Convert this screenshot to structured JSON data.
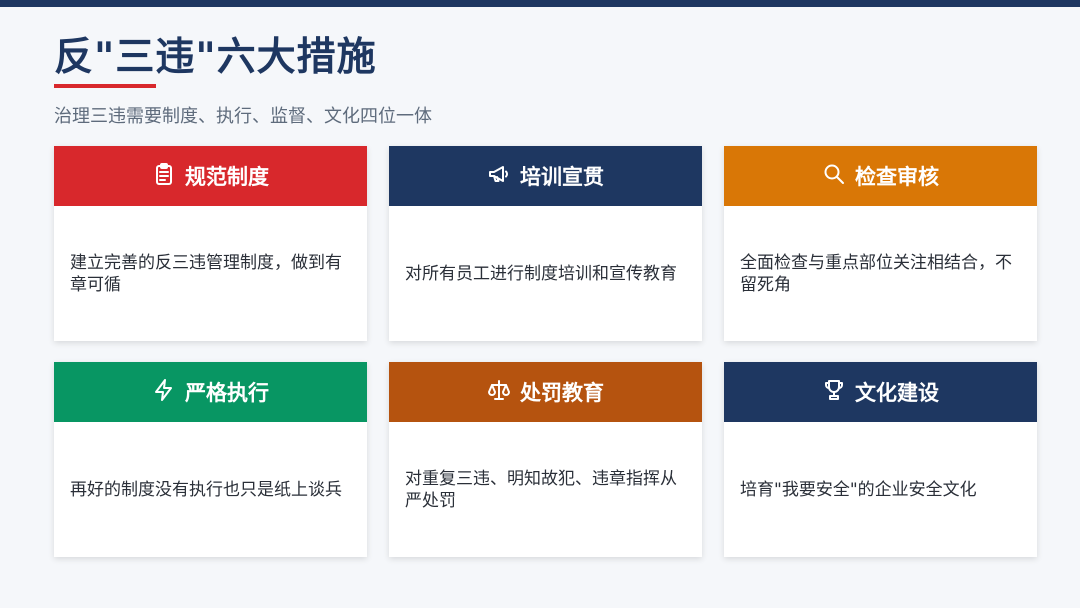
{
  "slide": {
    "title": "反\"三违\"六大措施",
    "subtitle": "治理三违需要制度、执行、监督、文化四位一体"
  },
  "colors": {
    "navy": "#1e3761",
    "red": "#d8282c",
    "orange": "#d97706",
    "green": "#089663",
    "brown": "#b5530f"
  },
  "cards": [
    {
      "title": "规范制度",
      "icon": "clipboard-icon",
      "color": "#d8282c",
      "text": "建立完善的反三违管理制度，做到有章可循"
    },
    {
      "title": "培训宣贯",
      "icon": "megaphone-icon",
      "color": "#1e3761",
      "text": "对所有员工进行制度培训和宣传教育"
    },
    {
      "title": "检查审核",
      "icon": "search-icon",
      "color": "#d97706",
      "text": "全面检查与重点部位关注相结合，不留死角"
    },
    {
      "title": "严格执行",
      "icon": "lightning-icon",
      "color": "#089663",
      "text": "再好的制度没有执行也只是纸上谈兵"
    },
    {
      "title": "处罚教育",
      "icon": "scales-icon",
      "color": "#b5530f",
      "text": "对重复三违、明知故犯、违章指挥从严处罚"
    },
    {
      "title": "文化建设",
      "icon": "trophy-icon",
      "color": "#1e3761",
      "text": "培育\"我要安全\"的企业安全文化"
    }
  ]
}
